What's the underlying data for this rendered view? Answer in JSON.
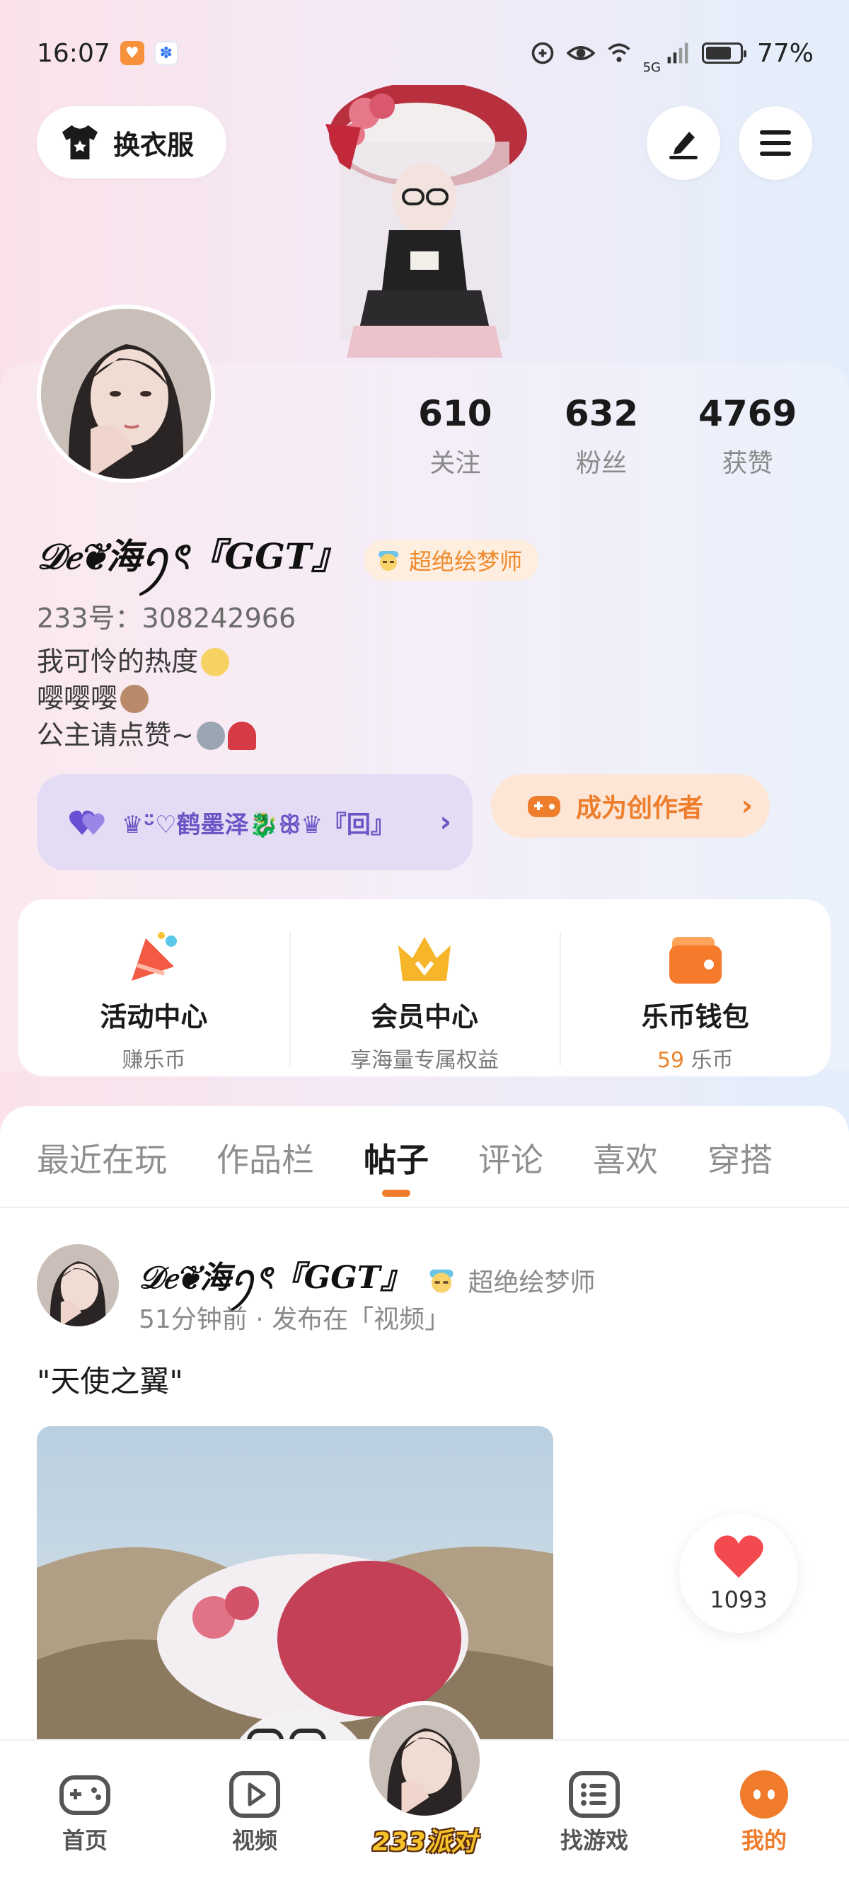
{
  "status_bar": {
    "time": "16:07",
    "signal_label": "5G",
    "battery_text": "77%",
    "battery_level": 0.77
  },
  "header": {
    "dress_button_label": "换衣服"
  },
  "profile": {
    "stats": [
      {
        "value": "610",
        "label": "关注"
      },
      {
        "value": "632",
        "label": "粉丝"
      },
      {
        "value": "4769",
        "label": "获赞"
      }
    ],
    "name": "𝒟𝑒❦海ꪆৎ『GGT』",
    "title_badge": "超绝绘梦师",
    "uid_label": "233号：",
    "uid_value": "308242966",
    "bio_lines": [
      "我可怜的热度",
      "嘤嘤嘤",
      "公主请点赞~"
    ],
    "relation_text": "♛ᵕ̈♡鹤墨泽🐉ꕥ♛『回』",
    "creator_label": "成为创作者"
  },
  "services": [
    {
      "title": "活动中心",
      "subtitle": "赚乐币"
    },
    {
      "title": "会员中心",
      "subtitle": "享海量专属权益"
    },
    {
      "title": "乐币钱包",
      "coin_value": "59",
      "coin_unit": " 乐币"
    }
  ],
  "tabs": [
    "最近在玩",
    "作品栏",
    "帖子",
    "评论",
    "喜欢",
    "穿搭"
  ],
  "active_tab": "帖子",
  "post": {
    "author": "𝒟𝑒❦海ꪆৎ『GGT』",
    "title_badge": "超绝绘梦师",
    "meta": "51分钟前 · 发布在「视频」",
    "text": "\"天使之翼\""
  },
  "like": {
    "count": "1093"
  },
  "bottom_nav": [
    {
      "label": "首页",
      "icon": "gamepad-icon"
    },
    {
      "label": "视频",
      "icon": "play-icon"
    },
    {
      "label": "233派对",
      "icon": "party-avatar"
    },
    {
      "label": "找游戏",
      "icon": "list-icon"
    },
    {
      "label": "我的",
      "icon": "profile-face-icon"
    }
  ],
  "colors": {
    "accent": "#ef7b2b",
    "purple": "#6a55c5",
    "badge_orange": "#f08a2c"
  }
}
